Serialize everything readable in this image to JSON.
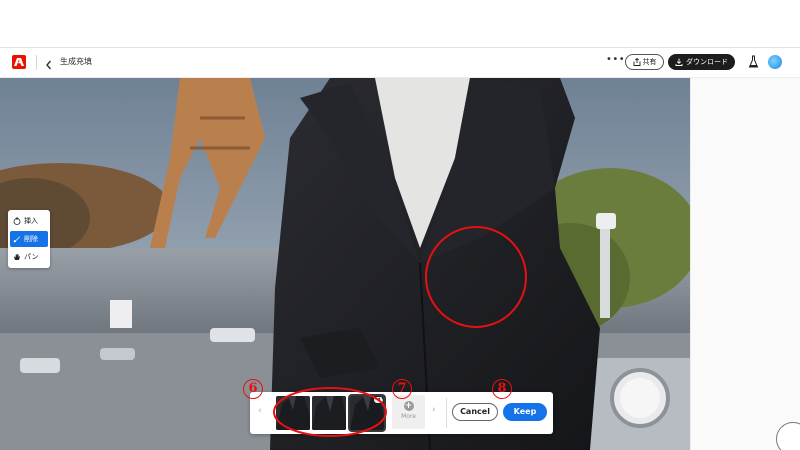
{
  "header": {
    "title": "生成充填",
    "more_label": "•••",
    "share_label": "共有",
    "download_label": "ダウンロード"
  },
  "tools": [
    {
      "label": "挿入",
      "icon": "insert-icon",
      "active": false
    },
    {
      "label": "削除",
      "icon": "brush-icon",
      "active": true
    },
    {
      "label": "パン",
      "icon": "hand-icon",
      "active": false
    }
  ],
  "variations": {
    "prev_label": "‹",
    "next_label": "›",
    "more_label": "More",
    "plus_label": "+",
    "menu_label": "•••"
  },
  "actions": {
    "cancel_label": "Cancel",
    "keep_label": "Keep"
  },
  "annotations": {
    "badge_6": "6",
    "badge_7": "7",
    "badge_8": "8"
  },
  "colors": {
    "accent": "#1473e6",
    "brand": "#eb1000",
    "annotation": "#e81010"
  }
}
